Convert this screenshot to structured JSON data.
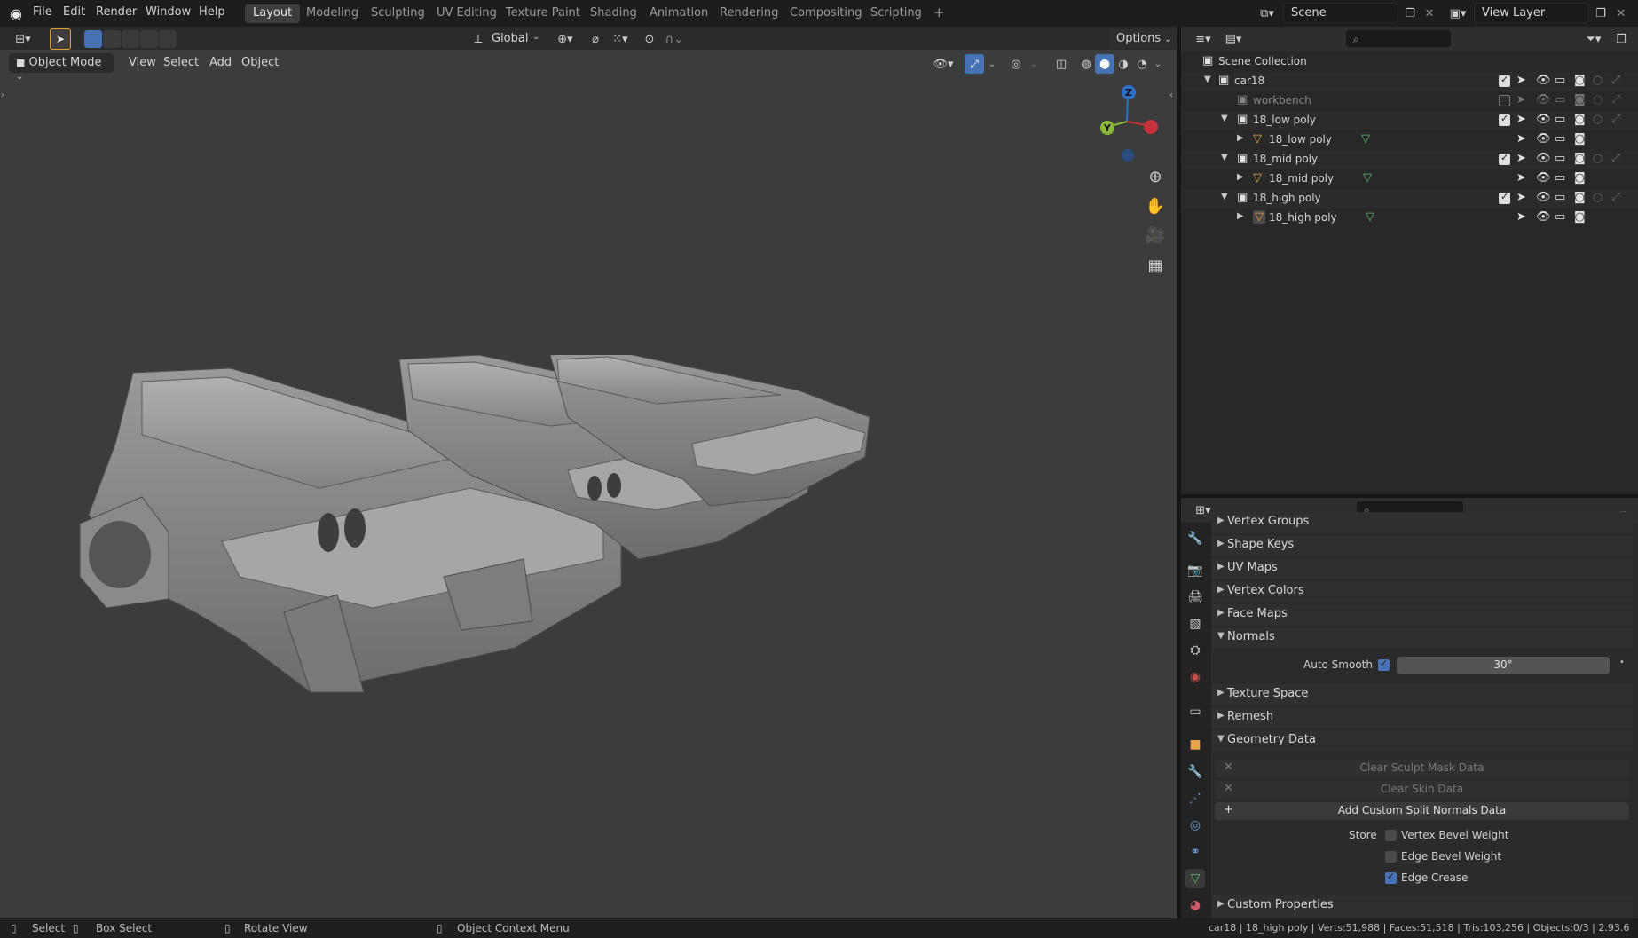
{
  "topbar": {
    "menus": [
      "File",
      "Edit",
      "Render",
      "Window",
      "Help"
    ],
    "workspaces": [
      "Layout",
      "Modeling",
      "Sculpting",
      "UV Editing",
      "Texture Paint",
      "Shading",
      "Animation",
      "Rendering",
      "Compositing",
      "Scripting"
    ],
    "active_workspace": "Layout",
    "add_workspace": "+",
    "scene": "Scene",
    "view_layer": "View Layer"
  },
  "viewport_header": {
    "transform_orientation": "Global",
    "options": "Options",
    "mode": "Object Mode",
    "menus": [
      "View",
      "Select",
      "Add",
      "Object"
    ]
  },
  "gizmo": {
    "z": "Z",
    "y": "Y",
    "x": ""
  },
  "outliner": {
    "root": "Scene Collection",
    "rows": [
      {
        "name": "car18",
        "type": "collection",
        "checked": true
      },
      {
        "name": "workbench",
        "type": "collection",
        "checked": false,
        "dimmed": true
      },
      {
        "name": "18_low poly",
        "type": "collection",
        "checked": true
      },
      {
        "name": "18_low poly",
        "type": "mesh"
      },
      {
        "name": "18_mid poly",
        "type": "collection",
        "checked": true
      },
      {
        "name": "18_mid poly",
        "type": "mesh"
      },
      {
        "name": "18_high poly",
        "type": "collection",
        "checked": true
      },
      {
        "name": "18_high poly",
        "type": "mesh"
      }
    ]
  },
  "properties": {
    "sections": {
      "vertex_groups": "Vertex Groups",
      "shape_keys": "Shape Keys",
      "uv_maps": "UV Maps",
      "vertex_colors": "Vertex Colors",
      "face_maps": "Face Maps",
      "normals": "Normals",
      "texture_space": "Texture Space",
      "remesh": "Remesh",
      "geometry_data": "Geometry Data",
      "custom_properties": "Custom Properties"
    },
    "auto_smooth": {
      "label": "Auto Smooth",
      "checked": true,
      "angle": "30°"
    },
    "buttons": {
      "clear_sculpt": "Clear Sculpt Mask Data",
      "clear_skin": "Clear Skin Data",
      "add_split_normals": "Add Custom Split Normals Data"
    },
    "store": {
      "label": "Store",
      "vertex_bevel": {
        "label": "Vertex Bevel Weight",
        "checked": false
      },
      "edge_bevel": {
        "label": "Edge Bevel Weight",
        "checked": false
      },
      "edge_crease": {
        "label": "Edge Crease",
        "checked": true
      }
    }
  },
  "statusbar": {
    "select": "Select",
    "box_select": "Box Select",
    "rotate_view": "Rotate View",
    "context_menu": "Object Context Menu",
    "stats": "car18 | 18_high poly | Verts:51,988 | Faces:51,518 | Tris:103,256 | Objects:0/3 | 2.93.6"
  },
  "colors": {
    "accent": "#4772b3",
    "mesh_icon": "#e8a24a",
    "data_icon": "#5bb86a",
    "axis_x": "#c8303a",
    "axis_y": "#8bb83a",
    "axis_z": "#2f6ec9"
  }
}
